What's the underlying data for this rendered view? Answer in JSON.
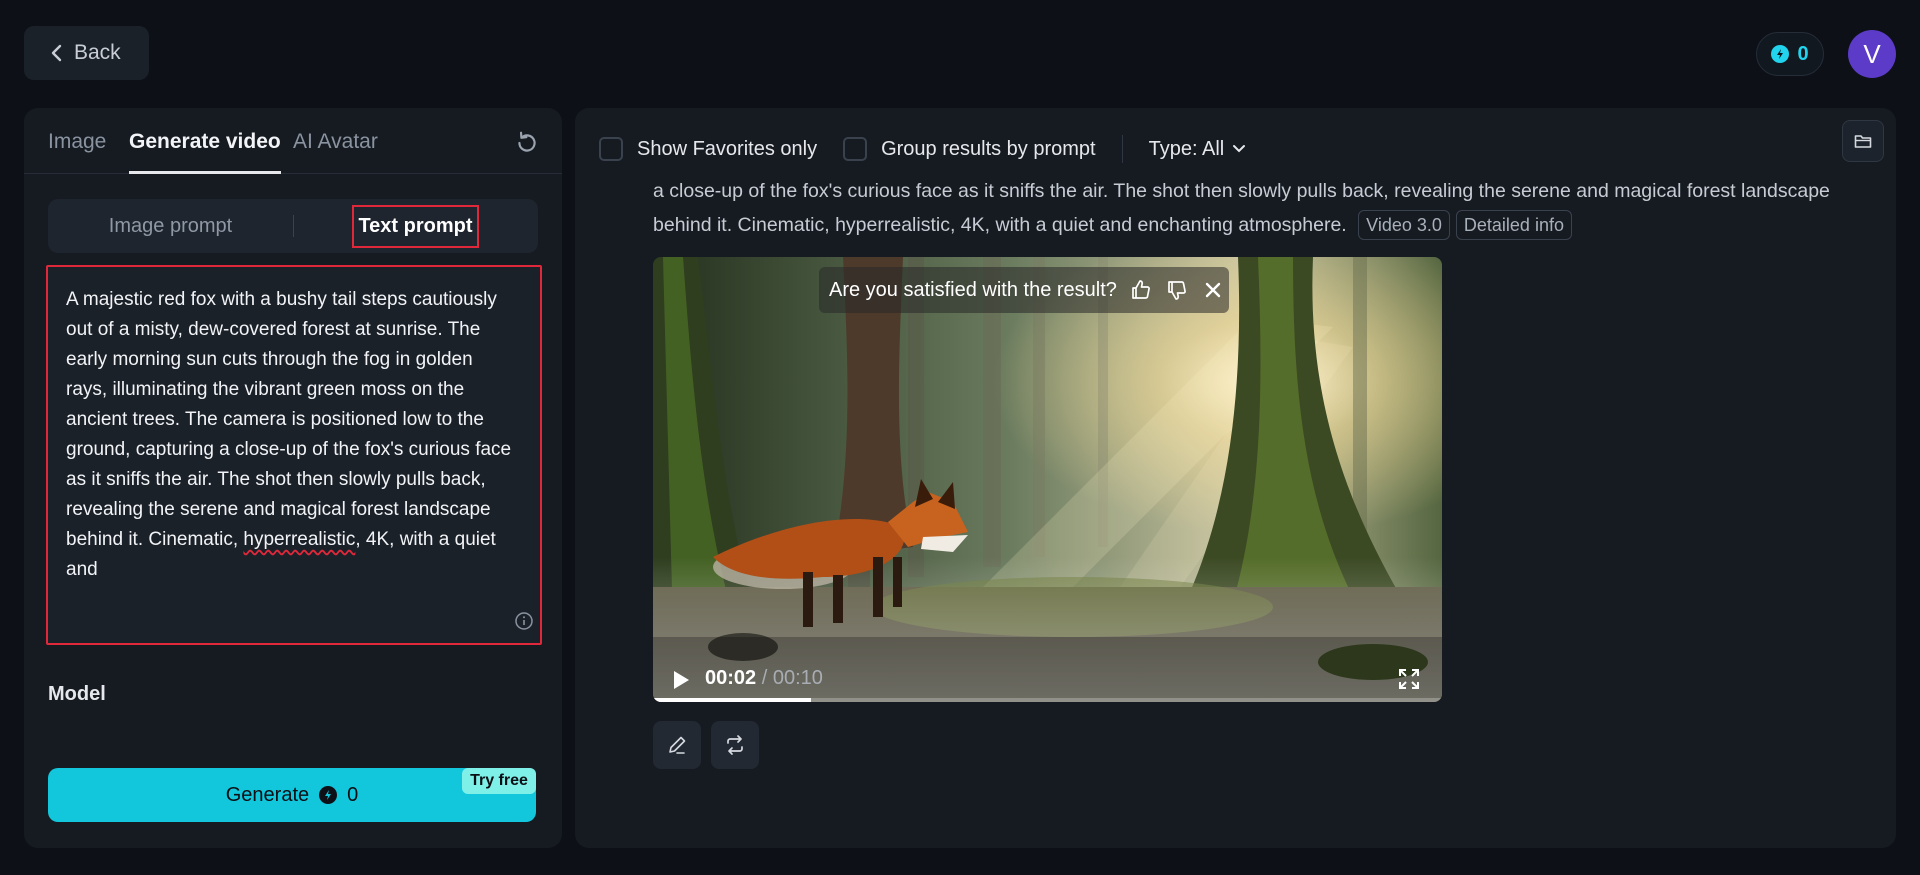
{
  "header": {
    "back_label": "Back",
    "credits": "0",
    "avatar_initial": "V"
  },
  "left": {
    "tabs": [
      {
        "label": "Image",
        "active": false
      },
      {
        "label": "Generate video",
        "active": true
      },
      {
        "label": "AI Avatar",
        "active": false
      }
    ],
    "prompt_modes": [
      {
        "label": "Image prompt",
        "selected": false
      },
      {
        "label": "Text prompt",
        "selected": true
      }
    ],
    "prompt_text_before": "A majestic red fox with a bushy tail steps cautiously out of a misty, dew-covered forest at sunrise. The early morning sun cuts through the fog in golden rays, illuminating the vibrant green moss on the ancient trees. The camera is positioned low to the ground, capturing a close-up of the fox's curious face as it sniffs the air. The shot then slowly pulls back, revealing the serene and magical forest landscape behind it. Cinematic, ",
    "prompt_text_spell": "hyperrealistic",
    "prompt_text_after": ", 4K, with a quiet and",
    "model_label": "Model",
    "generate_label": "Generate",
    "generate_cost": "0",
    "try_free_label": "Try free"
  },
  "right": {
    "show_favorites_label": "Show Favorites only",
    "group_label": "Group results by prompt",
    "type_label": "Type: All",
    "prompt_desc": "a close-up of the fox's curious face as it sniffs the air. The shot then slowly pulls back, revealing the serene and magical forest landscape behind it. Cinematic, hyperrealistic, 4K, with a quiet and enchanting atmosphere.",
    "chip_model": "Video 3.0",
    "chip_info": "Detailed info",
    "feedback_question": "Are you satisfied with the result?",
    "time_current": "00:02",
    "time_separator": " / ",
    "time_total": "00:10",
    "progress": 0.2
  },
  "colors": {
    "accent": "#12c6dc",
    "highlight_border": "#e0283a",
    "avatar": "#5b3bc7"
  }
}
